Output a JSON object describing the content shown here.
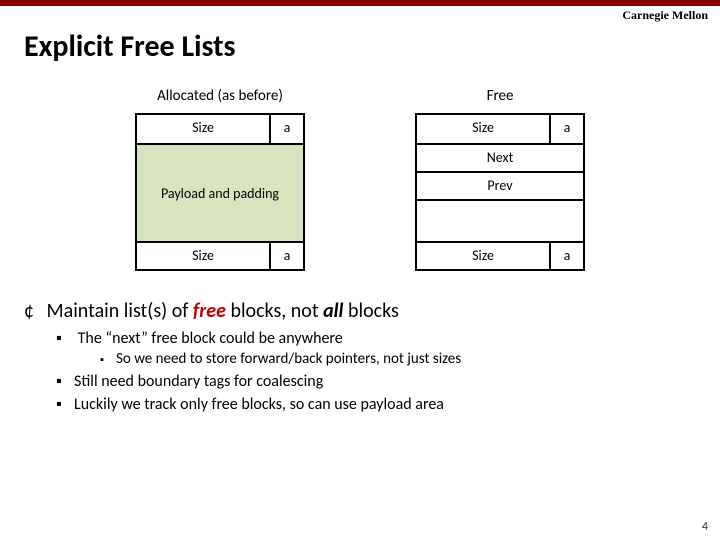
{
  "header": {
    "org": "Carnegie Mellon"
  },
  "title": "Explicit Free Lists",
  "allocated": {
    "label": "Allocated (as before)",
    "hdr_size": "Size",
    "hdr_a": "a",
    "payload": "Payload and padding",
    "ftr_size": "Size",
    "ftr_a": "a"
  },
  "free": {
    "label": "Free",
    "hdr_size": "Size",
    "hdr_a": "a",
    "next": "Next",
    "prev": "Prev",
    "ftr_size": "Size",
    "ftr_a": "a"
  },
  "main_point": {
    "pre": "Maintain list(s) of ",
    "free_word": "free",
    "mid": " blocks, not ",
    "all_word": "all",
    "post": " blocks"
  },
  "sub": {
    "b1": "The “next” free block could be anywhere",
    "b1_1": "So we need to store forward/back pointers, not just sizes",
    "b2": "Still need boundary tags for coalescing",
    "b3": "Luckily we track only free blocks, so can use payload area"
  },
  "pagenum": "4"
}
